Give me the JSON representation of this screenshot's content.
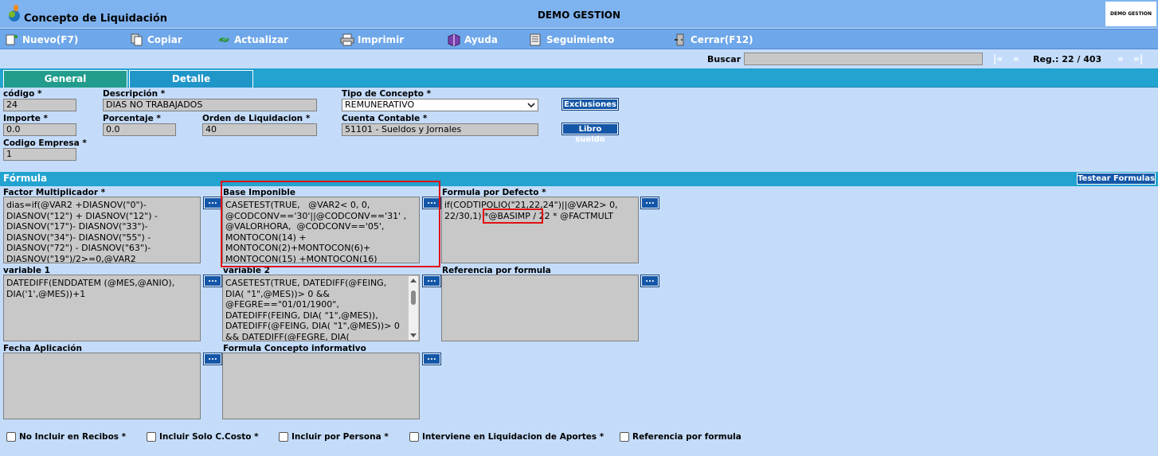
{
  "window": {
    "title": "Concepto de Liquidación",
    "company": "DEMO GESTION",
    "brand": "DEMO GESTION"
  },
  "toolbar": {
    "nuevo": "Nuevo(F7)",
    "copiar": "Copiar",
    "actualizar": "Actualizar",
    "imprimir": "Imprimir",
    "ayuda": "Ayuda",
    "seguimiento": "Seguimiento",
    "cerrar": "Cerrar(F12)"
  },
  "search": {
    "label": "Buscar",
    "value": "",
    "first": "|«",
    "prev": "«",
    "next": "»",
    "last": "»|",
    "record": "Reg.: 22 / 403"
  },
  "tabs": [
    {
      "label": "General",
      "active": true
    },
    {
      "label": "Detalle",
      "active": false
    }
  ],
  "form": {
    "codigo": {
      "label": "código *",
      "value": "24"
    },
    "descripcion": {
      "label": "Descripción *",
      "value": "DIAS NO TRABAJADOS"
    },
    "tipo": {
      "label": "Tipo de Concepto *",
      "value": "REMUNERATIVO"
    },
    "exclusiones": "Exclusiones",
    "importe": {
      "label": "Importe *",
      "value": "0.0"
    },
    "porcentaje": {
      "label": "Porcentaje *",
      "value": "0.0"
    },
    "orden": {
      "label": "Orden de Liquidacion *",
      "value": "40"
    },
    "cuenta": {
      "label": "Cuenta Contable *",
      "value": "51101 - Sueldos y Jornales"
    },
    "libro": "Libro sueldo",
    "empresa": {
      "label": "Codigo Empresa *",
      "value": "1"
    }
  },
  "formula": {
    "section_title": "Fórmula",
    "test_button": "Testear Formulas",
    "dots": "...",
    "factor": {
      "label": "Factor Multiplicador *",
      "value": "dias=if(@VAR2 +DIASNOV(\"0\")-DIASNOV(\"12\") + DIASNOV(\"12\") -DIASNOV(\"17\")- DIASNOV(\"33\")-DIASNOV(\"34\")- DIASNOV(\"55\") -DIASNOV(\"72\") - DIASNOV(\"63\")-DIASNOV(\"19\")/2>=0,@VAR2"
    },
    "base": {
      "label": "Base Imponible",
      "value": "CASETEST(TRUE,   @VAR2< 0, 0,  @CODCONV=='30'||@CODCONV=='31' , @VALORHORA,  @CODCONV=='05',  MONTOCON(14) + MONTOCON(2)+MONTOCON(6)+ MONTOCON(15) +MONTOCON(16)"
    },
    "defecto": {
      "label": "Formula por Defecto *",
      "line1": "if(CODTIPOLIO(\"21,22,24\")||@VAR2> 0,",
      "pre": "22/30,1) ",
      "highlight": "*@BASIMP /",
      "post": " 22 * @FACTMULT"
    },
    "variable1": {
      "label": "variable 1",
      "value": "DATEDIFF(ENDDATEM (@MES,@ANIO), DIA('1',@MES))+1"
    },
    "variable2": {
      "label": "variable 2",
      "value": "CASETEST(TRUE, DATEDIFF(@FEING, DIA( \"1\",@MES))> 0 && @FEGRE==\"01/01/1900\", DATEDIFF(FEING, DIA( \"1\",@MES)), DATEDIFF(@FEING, DIA( \"1\",@MES))> 0 && DATEDIFF(@FEGRE, DIA("
    },
    "referencia": {
      "label": "Referencia por formula",
      "value": ""
    },
    "fecha": {
      "label": "Fecha Aplicación",
      "value": ""
    },
    "informativo": {
      "label": "Formula Concepto informativo",
      "value": ""
    }
  },
  "checks": [
    {
      "label": "No Incluir en Recibos *"
    },
    {
      "label": "Incluir Solo C.Costo *"
    },
    {
      "label": "Incluir por Persona *"
    },
    {
      "label": "Interviene en Liquidacion de Aportes *"
    },
    {
      "label": "Referencia por formula"
    }
  ],
  "colors": {
    "titlebar": "#7eb3ef",
    "toolbar": "#6ea7ea",
    "tabs": "#22a3d0",
    "active_tab": "#229c8c",
    "field": "#c8c8c8",
    "button": "#1457a8",
    "highlight_box": "#e01010"
  }
}
